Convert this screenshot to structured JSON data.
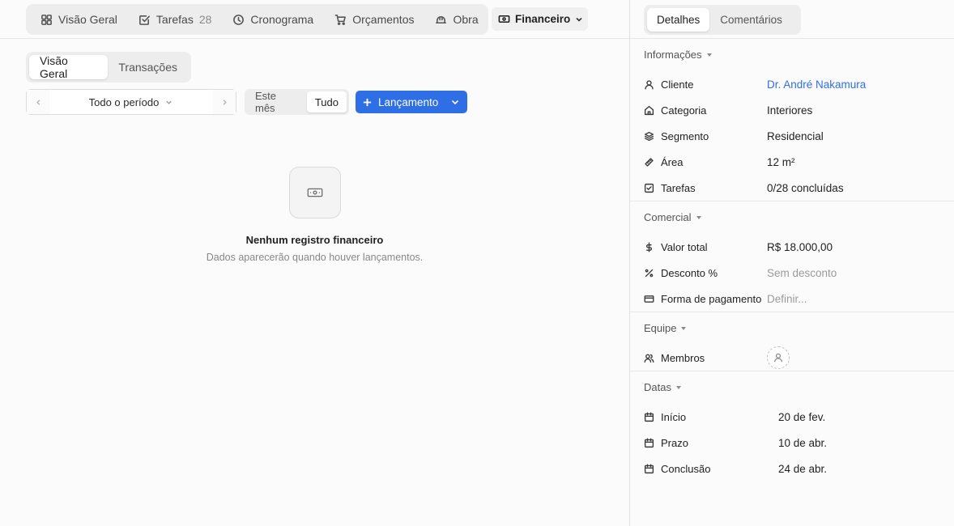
{
  "nav": {
    "tabs": [
      {
        "label": "Visão Geral",
        "icon": "grid-icon"
      },
      {
        "label": "Tarefas",
        "count": "28",
        "icon": "check-square-icon"
      },
      {
        "label": "Cronograma",
        "icon": "clock-icon"
      },
      {
        "label": "Orçamentos",
        "icon": "cart-icon"
      },
      {
        "label": "Obra",
        "icon": "helmet-icon"
      }
    ],
    "active": {
      "label": "Financeiro",
      "icon": "money-icon"
    }
  },
  "subtabs": {
    "active": "Visão Geral",
    "other": "Transações"
  },
  "period": {
    "label": "Todo o período"
  },
  "range": {
    "this_month": "Este mês",
    "all": "Tudo",
    "selected": "Tudo"
  },
  "launch_button": {
    "label": "Lançamento"
  },
  "empty_state": {
    "title": "Nenhum registro financeiro",
    "subtitle": "Dados aparecerão quando houver lançamentos."
  },
  "right_tabs": {
    "active": "Detalhes",
    "other": "Comentários"
  },
  "sections": {
    "info": {
      "title": "Informações",
      "rows": [
        {
          "label": "Cliente",
          "value": "Dr. André Nakamura"
        },
        {
          "label": "Categoria",
          "value": "Interiores"
        },
        {
          "label": "Segmento",
          "value": "Residencial"
        },
        {
          "label": "Área",
          "value": "12 m²"
        },
        {
          "label": "Tarefas",
          "value": "0/28 concluídas"
        }
      ]
    },
    "commercial": {
      "title": "Comercial",
      "rows": [
        {
          "label": "Valor total",
          "value": "R$ 18.000,00"
        },
        {
          "label": "Desconto %",
          "value": "Sem desconto"
        },
        {
          "label": "Forma de pagamento",
          "value": "Definir..."
        }
      ]
    },
    "team": {
      "title": "Equipe",
      "rows": [
        {
          "label": "Membros"
        }
      ]
    },
    "dates": {
      "title": "Datas",
      "rows": [
        {
          "label": "Início",
          "value": "20 de fev."
        },
        {
          "label": "Prazo",
          "value": "10 de abr."
        },
        {
          "label": "Conclusão",
          "value": "24 de abr."
        }
      ]
    }
  },
  "colors": {
    "accent": "#2f6fe6",
    "background": "#fbfbfb",
    "tab_group": "#ededed"
  }
}
